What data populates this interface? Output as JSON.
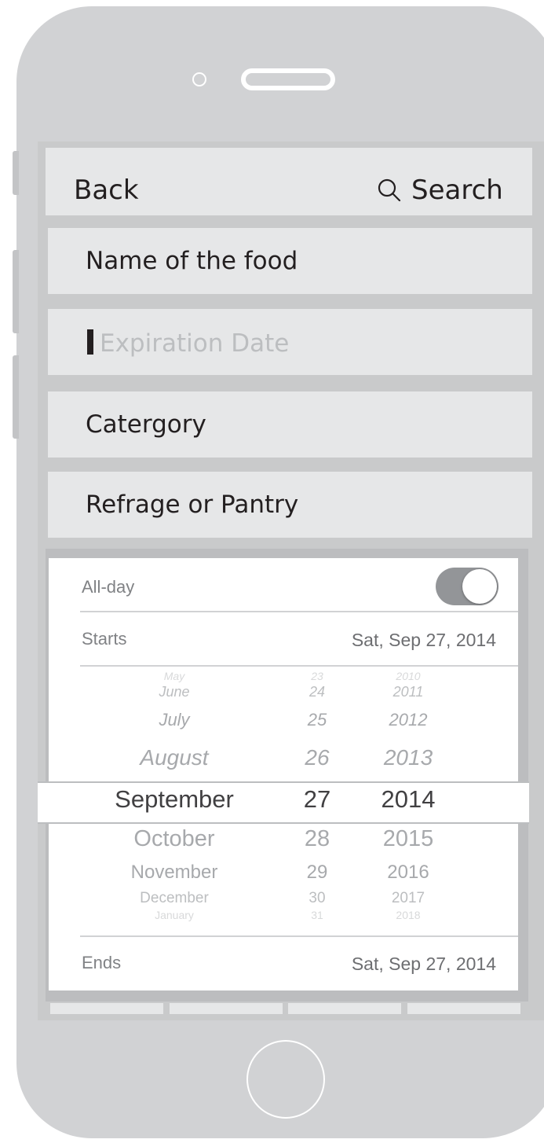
{
  "nav": {
    "back_label": "Back",
    "search_label": "Search"
  },
  "form": {
    "name_label": "Name of the food",
    "expiration_placeholder": "Expiration Date",
    "category_label": "Catergory",
    "location_label": "Refrage or Pantry"
  },
  "picker": {
    "allday_label": "All-day",
    "allday_on": true,
    "starts_label": "Starts",
    "starts_value": "Sat, Sep 27, 2014",
    "ends_label": "Ends",
    "ends_value": "Sat, Sep 27, 2014",
    "months": [
      "May",
      "June",
      "July",
      "August",
      "September",
      "October",
      "November",
      "December",
      "January"
    ],
    "days": [
      "23",
      "24",
      "25",
      "26",
      "27",
      "28",
      "29",
      "30",
      "31"
    ],
    "years": [
      "2010",
      "2011",
      "2012",
      "2013",
      "2014",
      "2015",
      "2016",
      "2017",
      "2018"
    ],
    "selected_index": 4
  }
}
